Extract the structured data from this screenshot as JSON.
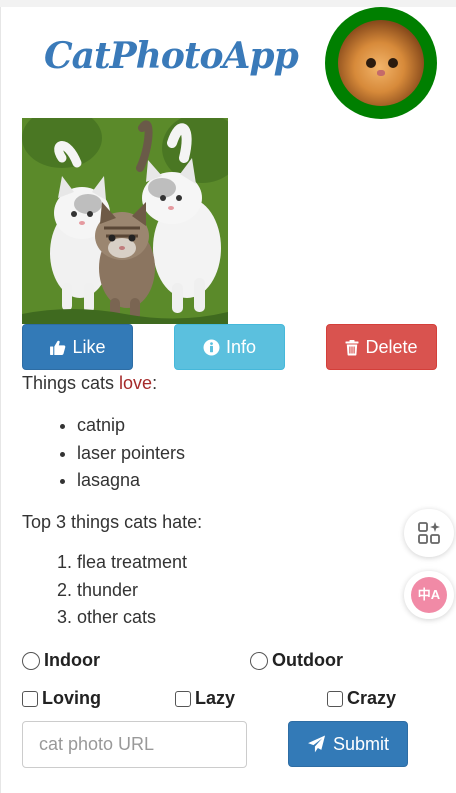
{
  "app": {
    "title": "CatPhotoApp"
  },
  "buttons": {
    "like": "Like",
    "info": "Info",
    "delete": "Delete",
    "submit": "Submit"
  },
  "love": {
    "prefix": "Things cats ",
    "highlight": "love",
    "suffix": ":",
    "items": [
      "catnip",
      "laser pointers",
      "lasagna"
    ]
  },
  "hate": {
    "heading": "Top 3 things cats hate:",
    "items": [
      "flea treatment",
      "thunder",
      "other cats"
    ]
  },
  "form": {
    "radios": [
      "Indoor",
      "Outdoor"
    ],
    "checkboxes": [
      "Loving",
      "Lazy",
      "Crazy"
    ],
    "url_placeholder": "cat photo URL"
  },
  "floating": {
    "translate_label": "中A"
  },
  "colors": {
    "title": "#3a7ab9",
    "avatar_ring": "#007f00",
    "like": "#337ab7",
    "info": "#5bc0de",
    "delete": "#d9534f",
    "love_highlight": "#a52a2a"
  },
  "icons": {
    "like": "thumbs-up-icon",
    "info": "info-circle-icon",
    "delete": "trash-icon",
    "submit": "paper-plane-icon",
    "apps": "apps-sparkle-icon",
    "translate": "translate-icon"
  }
}
